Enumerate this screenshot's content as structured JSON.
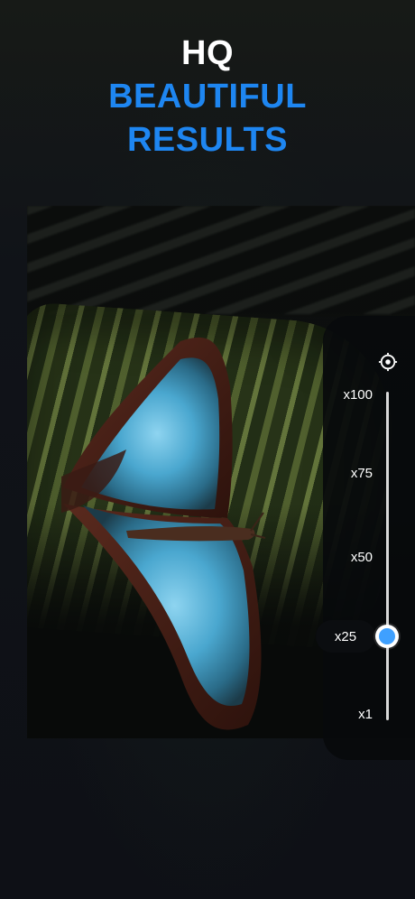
{
  "headline": {
    "line1": "HQ",
    "line2": "BEAUTIFUL",
    "line3": "RESULTS"
  },
  "zoom": {
    "levels": [
      "x100",
      "x75",
      "x50",
      "x25",
      "x1"
    ],
    "selected": "x25",
    "settings_icon": "settings-gear-icon",
    "accent_color": "#3fa0ff"
  },
  "colors": {
    "headline_white": "#ffffff",
    "headline_blue": "#1e86f1",
    "background": "#0f1118"
  }
}
